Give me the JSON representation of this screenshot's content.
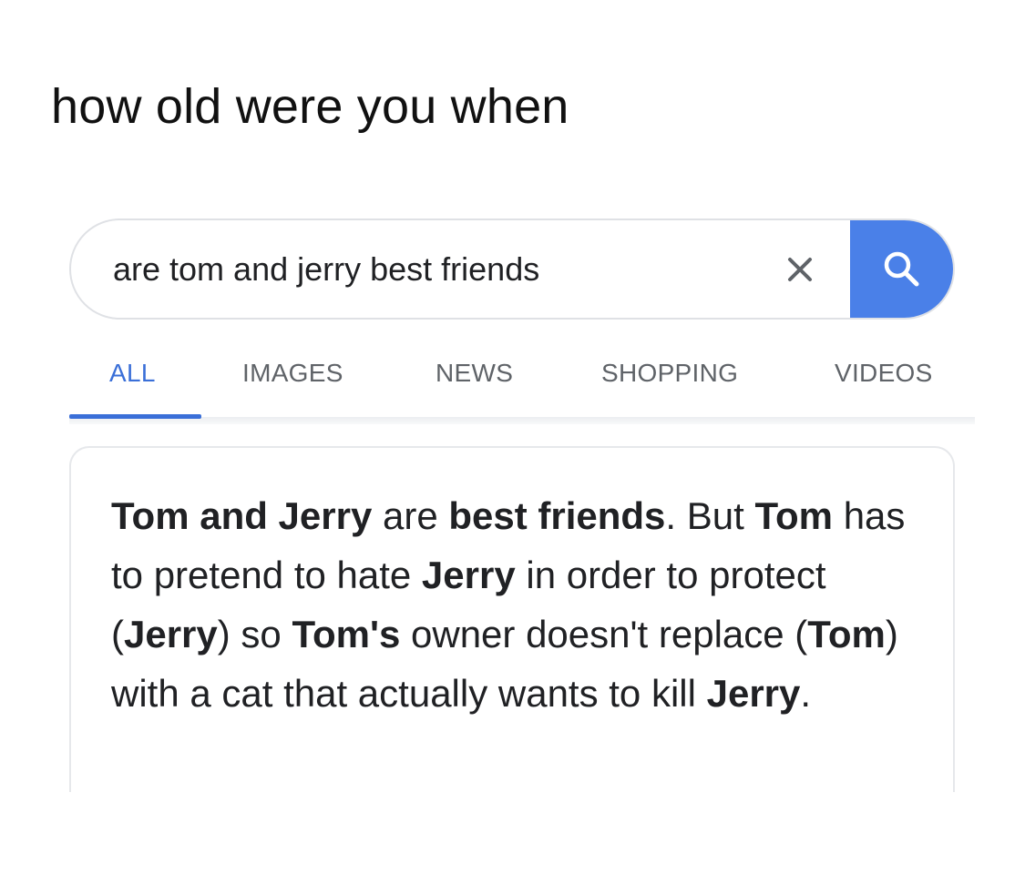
{
  "caption": "how old were you when",
  "search": {
    "query": "are tom and jerry best friends",
    "clear_icon": "close-icon",
    "search_icon": "search-icon",
    "accent_color": "#4a80e8"
  },
  "tabs": [
    {
      "label": "ALL",
      "active": true
    },
    {
      "label": "IMAGES",
      "active": false
    },
    {
      "label": "NEWS",
      "active": false
    },
    {
      "label": "SHOPPING",
      "active": false
    },
    {
      "label": "VIDEOS",
      "active": false
    }
  ],
  "answer": {
    "segments": [
      {
        "text": "Tom and Jerry",
        "bold": true
      },
      {
        "text": " are ",
        "bold": false
      },
      {
        "text": "best friends",
        "bold": true
      },
      {
        "text": ". But ",
        "bold": false
      },
      {
        "text": "Tom",
        "bold": true
      },
      {
        "text": " has to pretend to hate ",
        "bold": false
      },
      {
        "text": "Jerry",
        "bold": true
      },
      {
        "text": " in order to protect (",
        "bold": false
      },
      {
        "text": "Jerry",
        "bold": true
      },
      {
        "text": ") so ",
        "bold": false
      },
      {
        "text": "Tom's",
        "bold": true
      },
      {
        "text": " owner doesn't replace (",
        "bold": false
      },
      {
        "text": "Tom",
        "bold": true
      },
      {
        "text": ") with a cat that actually wants to kill ",
        "bold": false
      },
      {
        "text": "Jerry",
        "bold": true
      },
      {
        "text": ".",
        "bold": false
      }
    ]
  }
}
